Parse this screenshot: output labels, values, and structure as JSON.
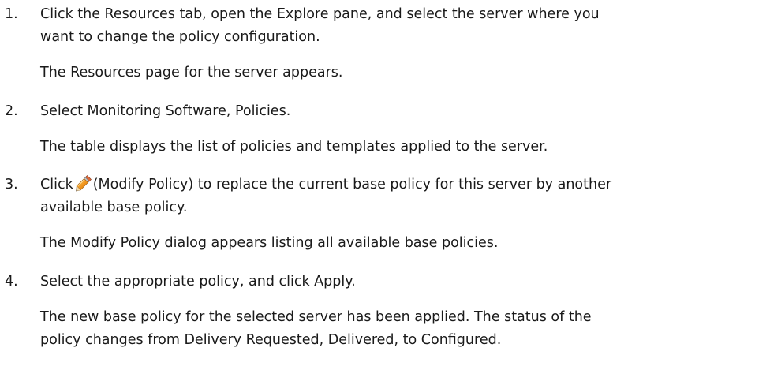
{
  "steps": [
    {
      "number": "1.",
      "instruction_line1": "Click the Resources tab, open the Explore pane, and select the server where you",
      "instruction_line2": "want to change the policy configuration.",
      "result": "The Resources page for the server appears."
    },
    {
      "number": "2.",
      "instruction": "Select Monitoring Software, Policies.",
      "result": "The table displays the list of policies and templates applied to the server."
    },
    {
      "number": "3.",
      "instruction_prefix": "Click",
      "icon": "pencil-edit-icon",
      "instruction_suffix": "(Modify Policy) to replace the current base policy for this server by another",
      "instruction_line2": "available base policy.",
      "result": "The Modify Policy dialog appears listing all available base policies."
    },
    {
      "number": "4.",
      "instruction": "Select the appropriate policy, and click Apply.",
      "result_line1": "The new base policy for the selected server has been applied. The status of the",
      "result_line2": "policy changes from Delivery Requested, Delivered, to Configured."
    }
  ],
  "colors": {
    "text": "#1a1a1a",
    "icon_orange": "#e88a1a",
    "icon_gray": "#8a8a8a"
  }
}
